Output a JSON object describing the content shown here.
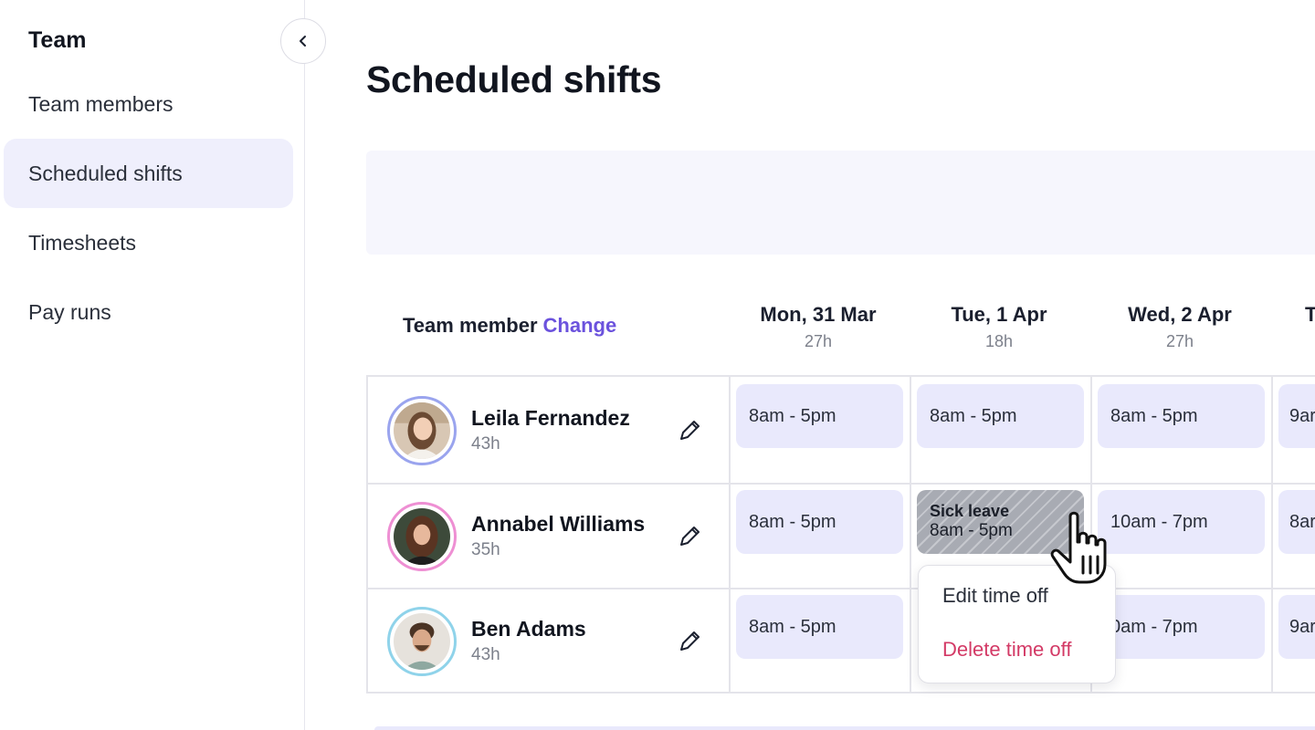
{
  "sidebar": {
    "title": "Team",
    "collapse_icon": "chevron-left-icon",
    "items": [
      {
        "label": "Team members",
        "active": false
      },
      {
        "label": "Scheduled shifts",
        "active": true
      },
      {
        "label": "Timesheets",
        "active": false
      },
      {
        "label": "Pay runs",
        "active": false
      }
    ]
  },
  "main": {
    "title": "Scheduled shifts",
    "table": {
      "member_header": "Team member",
      "change_link": "Change",
      "days": [
        {
          "label": "Mon, 31 Mar",
          "hours": "27h"
        },
        {
          "label": "Tue, 1 Apr",
          "hours": "18h"
        },
        {
          "label": "Wed, 2 Apr",
          "hours": "27h"
        },
        {
          "label": "T",
          "hours": ""
        }
      ],
      "rows": [
        {
          "name": "Leila Fernandez",
          "hours": "43h",
          "ring_color": "#9aa4ee",
          "shifts": [
            "8am - 5pm",
            "8am - 5pm",
            "8am - 5pm",
            "9ar"
          ]
        },
        {
          "name": "Annabel Williams",
          "hours": "35h",
          "ring_color": "#ee8fd3",
          "shifts": [
            "8am - 5pm",
            "8am - 5pm",
            "10am - 7pm",
            "8ar"
          ],
          "time_off": {
            "label": "Sick leave",
            "time": "8am - 5pm"
          }
        },
        {
          "name": "Ben Adams",
          "hours": "43h",
          "ring_color": "#8fd3ea",
          "shifts": [
            "8am - 5pm",
            "",
            "0am - 7pm",
            "9ar"
          ]
        }
      ]
    }
  },
  "context_menu": {
    "edit_label": "Edit time off",
    "delete_label": "Delete time off"
  },
  "colors": {
    "accent": "#6b52dd",
    "shift_bg": "#e9e9fc",
    "danger": "#d33a66"
  }
}
